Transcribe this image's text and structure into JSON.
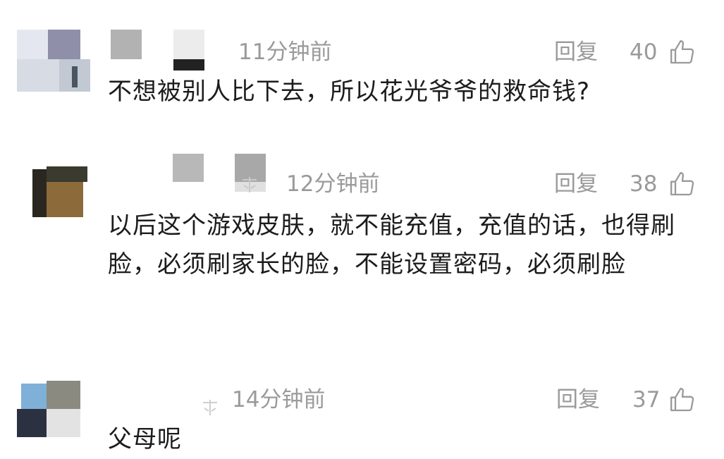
{
  "comments": [
    {
      "time": "11分钟前",
      "reply_label": "回复",
      "likes": "40",
      "like_icon": "thumbs-up-icon",
      "text": "不想被别人比下去，所以花光爷爷的救命钱?"
    },
    {
      "time": "12分钟前",
      "reply_label": "回复",
      "likes": "38",
      "like_icon": "thumbs-up-icon",
      "text": "以后这个游戏皮肤，就不能充值，充值的话，也得刷脸，必须刷家长的脸，不能设置密码，必须刷脸"
    },
    {
      "time": "14分钟前",
      "reply_label": "回复",
      "likes": "37",
      "like_icon": "thumbs-up-icon",
      "text": "父母呢"
    }
  ],
  "colors": {
    "meta_text": "#9a9a9a",
    "body_text": "#1c1c1c",
    "background": "#ffffff"
  }
}
